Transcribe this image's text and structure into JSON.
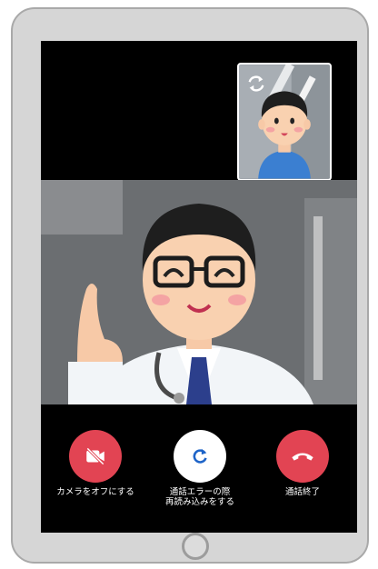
{
  "controls": {
    "camera_off": {
      "label": "カメラをオフにする",
      "icon": "video-off-icon",
      "color": "#e24453"
    },
    "reload": {
      "label": "通話エラーの際\n再読み込みをする",
      "icon": "refresh-icon",
      "color": "#ffffff"
    },
    "end_call": {
      "label": "通話終了",
      "icon": "phone-hangup-icon",
      "color": "#e24453"
    }
  },
  "pip": {
    "switch_camera_icon": "camera-switch-icon"
  },
  "icons": {
    "home_button": "home-button-icon"
  },
  "colors": {
    "screen": "#000000",
    "accent_red": "#e24453",
    "accent_blue": "#1e64c8",
    "frame": "#d6d6d6"
  }
}
